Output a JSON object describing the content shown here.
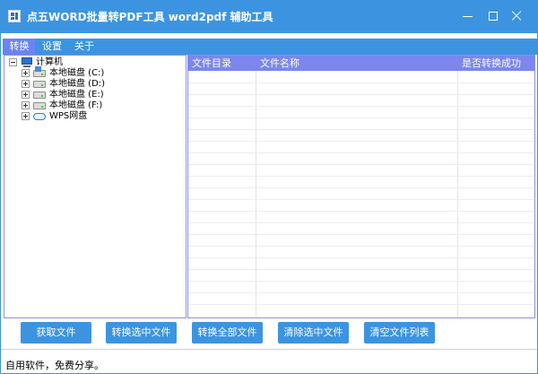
{
  "window": {
    "title": "点五WORD批量转PDF工具 word2pdf 辅助工具",
    "colors": {
      "accent": "#3c94e0",
      "tab_active": "#6c83f2",
      "list_header": "#7b86ee"
    }
  },
  "tabs": [
    {
      "label": "转换",
      "active": true
    },
    {
      "label": "设置",
      "active": false
    },
    {
      "label": "关于",
      "active": false
    }
  ],
  "tree": {
    "root": {
      "label": "计算机",
      "icon": "computer-icon"
    },
    "items": [
      {
        "label": "本地磁盘 (C:)",
        "icon": "system-drive-icon"
      },
      {
        "label": "本地磁盘 (D:)",
        "icon": "drive-icon"
      },
      {
        "label": "本地磁盘 (E:)",
        "icon": "drive-icon"
      },
      {
        "label": "本地磁盘 (F:)",
        "icon": "drive-icon"
      },
      {
        "label": "WPS网盘",
        "icon": "cloud-drive-icon"
      }
    ]
  },
  "file_list": {
    "columns": [
      "文件目录",
      "文件名称",
      "是否转换成功"
    ],
    "rows": []
  },
  "buttons": {
    "get_files": "获取文件",
    "convert_selected": "转换选中文件",
    "convert_all": "转换全部文件",
    "clear_selected": "清除选中文件",
    "clear_list": "清空文件列表"
  },
  "status": {
    "text": "自用软件，免费分享。"
  }
}
